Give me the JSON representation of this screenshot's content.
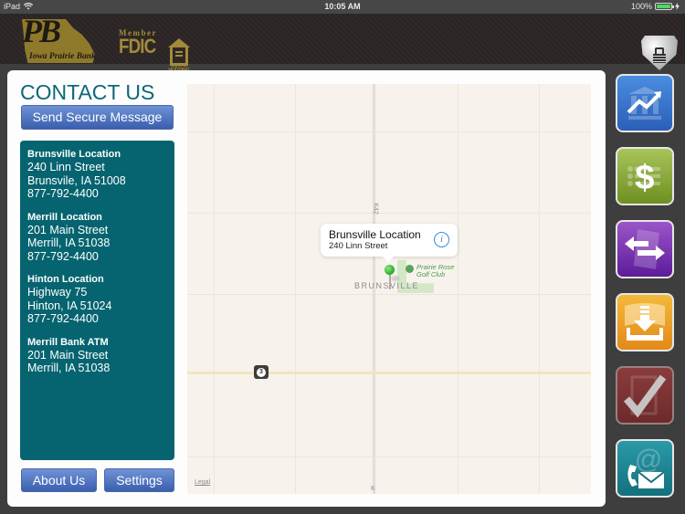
{
  "status_bar": {
    "device": "iPad",
    "time": "10:05 AM",
    "battery": "100%",
    "battery_level": 1.0
  },
  "header": {
    "logo_initials": "PB",
    "logo_name": "Iowa Prairie Bank",
    "fdic_member": "Member",
    "fdic": "FDIC",
    "equal_housing": "EQUAL HOUSING LENDER",
    "lock_icon": "lock-shield-icon"
  },
  "contact": {
    "title": "CONTACT US",
    "send_secure_message": "Send Secure Message",
    "locations": [
      {
        "name": "Brunsville Location",
        "lines": [
          "240 Linn Street",
          "Brunsvile, IA 51008",
          "877-792-4400"
        ]
      },
      {
        "name": "Merrill Location",
        "lines": [
          "201 Main Street",
          "Merrill, IA 51038",
          "877-792-4400"
        ]
      },
      {
        "name": "Hinton Location",
        "lines": [
          "Highway 75",
          "Hinton, IA 51024",
          "877-792-4400"
        ]
      },
      {
        "name": "Merrill Bank ATM",
        "lines": [
          "201 Main Street",
          "Merrill, IA 51038"
        ]
      }
    ],
    "about_us": "About Us",
    "settings": "Settings"
  },
  "map": {
    "callout_title": "Brunsville Location",
    "callout_subtitle": "240 Linn Street",
    "town_label": "BRUNSVILLE",
    "poi_label_1": "Prairie Rose",
    "poi_label_2": "Golf Club",
    "road_label": "K42",
    "road_label_bottom": "K",
    "highway_shield": "3",
    "legal": "Legal",
    "pin_color": "#2fb52f"
  },
  "side_nav": [
    {
      "icon": "accounts-chart-icon",
      "color": "#3a74cc"
    },
    {
      "icon": "dollar-list-icon",
      "color": "#8aab3a"
    },
    {
      "icon": "transfer-arrows-icon",
      "color": "#7a35b0"
    },
    {
      "icon": "deposit-download-icon",
      "color": "#eca32a"
    },
    {
      "icon": "checklist-icon",
      "color": "#7c3333"
    },
    {
      "icon": "contact-phone-mail-icon",
      "color": "#1f8592"
    }
  ]
}
